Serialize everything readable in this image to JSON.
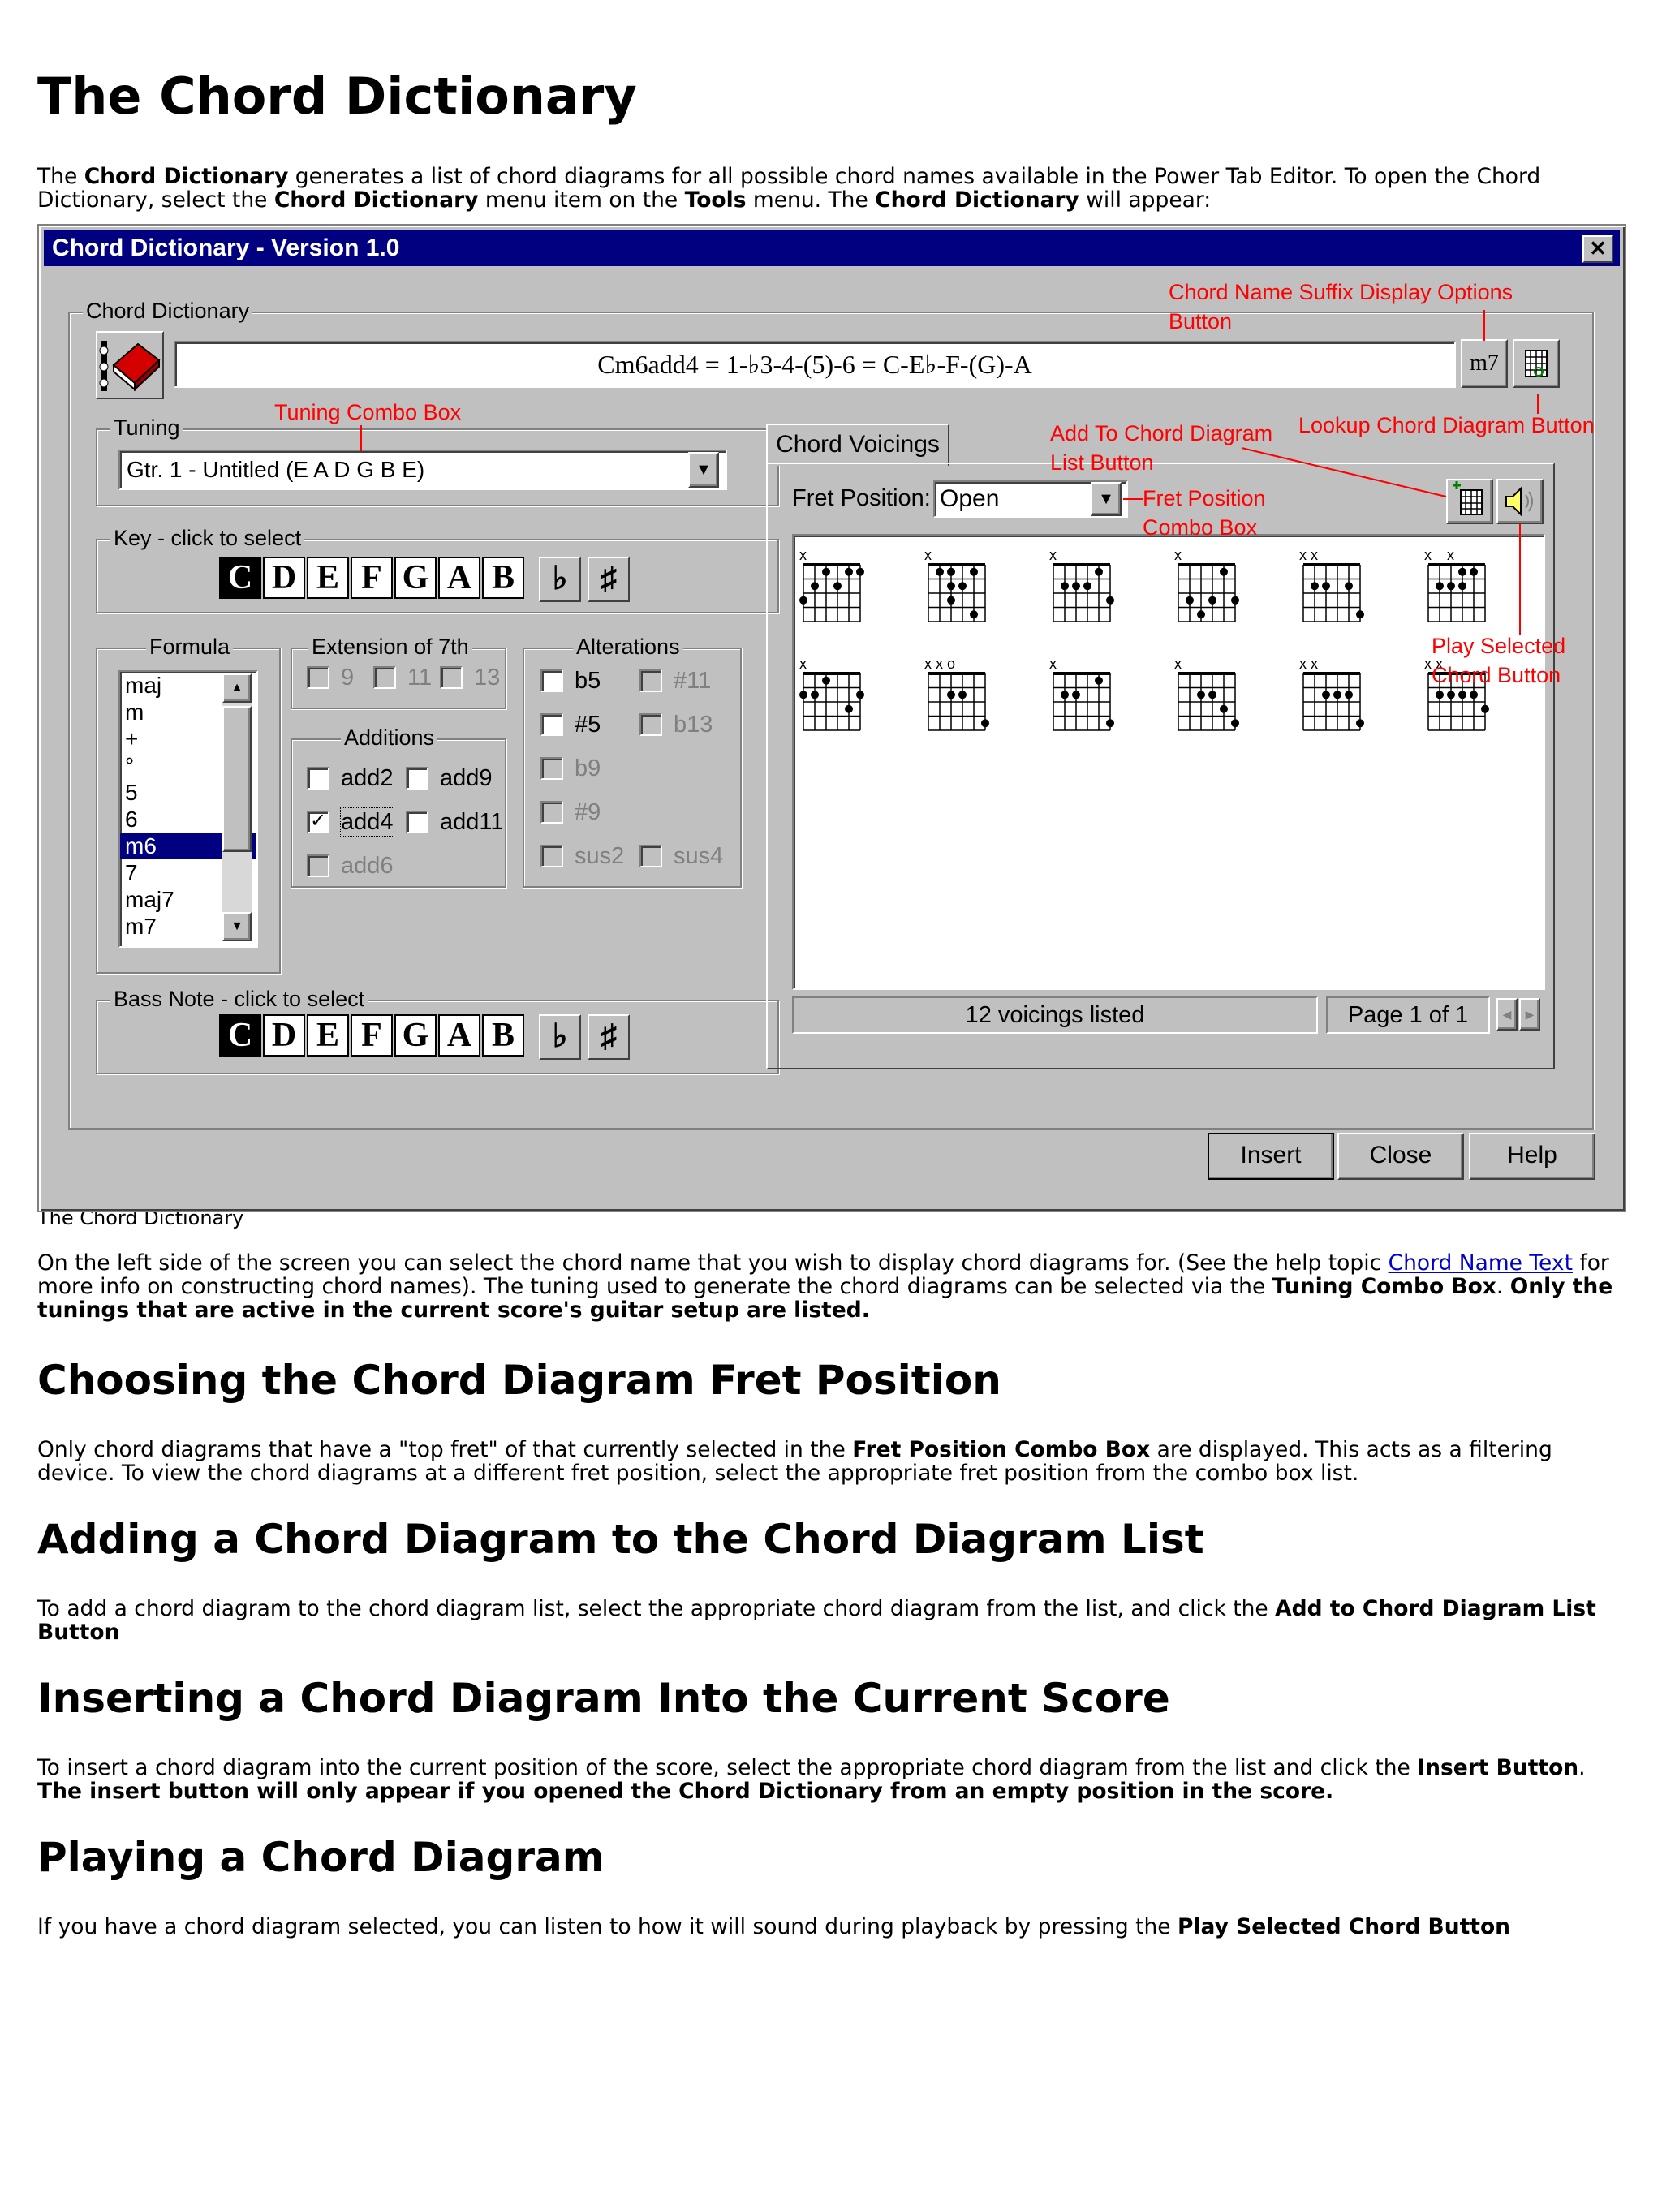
{
  "page": {
    "title": "The Chord Dictionary",
    "intro": {
      "t1": "The ",
      "b1": "Chord Dictionary",
      "t2": " generates a list of chord diagrams for all possible chord names available in the Power Tab Editor. To open the Chord Dictionary, select the ",
      "b2": "Chord Dictionary",
      "t3": " menu item on the ",
      "b3": "Tools",
      "t4": " menu. The ",
      "b4": "Chord Dictionary",
      "t5": " will appear:"
    },
    "caption": "The Chord Dictionary",
    "para_left": {
      "t1": "On the left side of the screen you can select the chord name that you wish to display chord diagrams for. (See the help topic ",
      "link": "Chord Name Text",
      "t2": " for more info on constructing chord names). The tuning used to generate the chord diagrams can be selected via the ",
      "b1": "Tuning Combo Box",
      "t3": ". ",
      "b2": "Only the tunings that are active in the current score's guitar setup are listed."
    },
    "sec_fret": {
      "heading": "Choosing the Chord Diagram Fret Position",
      "t1": "Only chord diagrams that have a \"top fret\" of that currently selected in the ",
      "b1": "Fret Position Combo Box",
      "t2": " are displayed. This acts as a filtering device. To view the chord diagrams at a different fret position, select the appropriate fret position from the combo box list."
    },
    "sec_add": {
      "heading": "Adding a Chord Diagram to the Chord Diagram List",
      "t1": "To add a chord diagram to the chord diagram list, select the appropriate chord diagram from the list, and click the ",
      "b1": "Add to Chord Diagram List Button"
    },
    "sec_insert": {
      "heading": "Inserting a Chord Diagram Into the Current Score",
      "t1": "To insert a chord diagram into the current position of the score, select the appropriate chord diagram from the list and click the ",
      "b1": "Insert Button",
      "t2": ". ",
      "b2": "The insert button will only appear if you opened the Chord Dictionary from an empty position in the score."
    },
    "sec_play": {
      "heading": "Playing a Chord Diagram",
      "t1": "If you have a chord diagram selected, you can listen to how it will sound during playback by pressing the ",
      "b1": "Play Selected Chord Button"
    }
  },
  "dialog": {
    "title": "Chord Dictionary - Version 1.0",
    "close_glyph": "✕",
    "group_label": "Chord Dictionary",
    "chord_formula": "Cm6add4 = 1-♭3-4-(5)-6 = C-E♭-F-(G)-A",
    "suffix_button": "m7",
    "tuning_label": "Tuning",
    "tuning_value": "Gtr. 1 - Untitled (E A D G B E)",
    "key_label": "Key - click to select",
    "bass_label": "Bass Note - click to select",
    "notes": [
      "C",
      "D",
      "E",
      "F",
      "G",
      "A",
      "B"
    ],
    "flat": "♭",
    "sharp": "♯",
    "formula_label": "Formula",
    "formulas": [
      "maj",
      "m",
      "+",
      "°",
      "5",
      "6",
      "m6",
      "7",
      "maj7",
      "m7"
    ],
    "selected_formula": "m6",
    "ext_label": "Extension of 7th",
    "extensions": [
      "9",
      "11",
      "13"
    ],
    "additions_label": "Additions",
    "additions": [
      "add2",
      "add9",
      "add4",
      "add11",
      "add6"
    ],
    "alterations_label": "Alterations",
    "alterations": [
      "b5",
      "#11",
      "#5",
      "b13",
      "b9",
      "#9",
      "sus2",
      "sus4"
    ],
    "voicings_tab": "Chord Voicings",
    "fret_label": "Fret Position:",
    "fret_value": "Open",
    "status": "12 voicings listed",
    "page_text": "Page 1 of 1",
    "buttons": {
      "insert": "Insert",
      "close": "Close",
      "help": "Help"
    },
    "mute_mark": "x",
    "open_mark": "o"
  },
  "callouts": {
    "suffix": "Chord Name Suffix Display Options\nButton",
    "tuning": "Tuning Combo Box",
    "lookup": "Lookup Chord Diagram Button",
    "add": "Add To Chord Diagram\nList Button",
    "fret": "Fret Position\nCombo Box",
    "play": "Play Selected\nChord Button"
  }
}
